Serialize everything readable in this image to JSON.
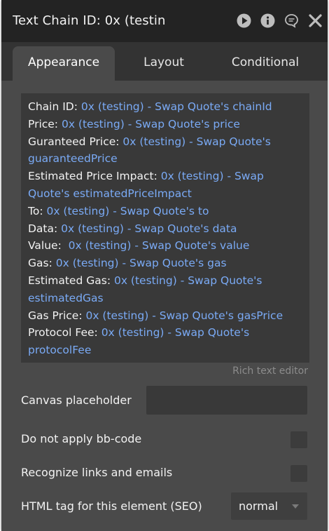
{
  "window": {
    "title": "Text Chain ID: 0x (testin"
  },
  "title_icons": [
    "play-icon",
    "info-icon",
    "comment-icon",
    "close-icon"
  ],
  "tabs": [
    {
      "label": "Appearance",
      "active": true
    },
    {
      "label": "Layout",
      "active": false
    },
    {
      "label": "Conditional",
      "active": false
    }
  ],
  "rich_text": {
    "lines": [
      {
        "label": "Chain ID:",
        "value": " 0x (testing) - Swap Quote's chainId"
      },
      {
        "label": "Price:",
        "value": " 0x (testing) - Swap Quote's price"
      },
      {
        "label": "Guranteed Price:",
        "value": " 0x (testing) - Swap Quote's guaranteedPrice"
      },
      {
        "label": "Estimated Price Impact:",
        "value": " 0x (testing) - Swap Quote's estimatedPriceImpact"
      },
      {
        "label": "To:",
        "value": " 0x (testing) - Swap Quote's to"
      },
      {
        "label": "Data:",
        "value": " 0x (testing) - Swap Quote's data"
      },
      {
        "label": "Value:",
        "value": "  0x (testing) - Swap Quote's value"
      },
      {
        "label": "Gas:",
        "value": " 0x (testing) - Swap Quote's gas"
      },
      {
        "label": "Estimated Gas:",
        "value": " 0x (testing) - Swap Quote's estimatedGas"
      },
      {
        "label": "Gas Price:",
        "value": " 0x (testing) - Swap Quote's gasPrice"
      },
      {
        "label": "Protocol Fee:",
        "value": " 0x (testing) - Swap Quote's protocolFee"
      }
    ],
    "caption": "Rich text editor"
  },
  "fields": {
    "canvas_placeholder": {
      "label": "Canvas placeholder",
      "value": ""
    },
    "no_bbcode": {
      "label": "Do not apply bb-code",
      "checked": false
    },
    "recognize_links": {
      "label": "Recognize links and emails",
      "checked": false
    },
    "html_tag": {
      "label": "HTML tag for this element (SEO)",
      "value": "normal"
    }
  },
  "colors": {
    "panel": "#2b2b2b",
    "content": "#4a4a4a",
    "dynamic_value": "#7aaaf5",
    "text": "#f2f2f2"
  }
}
